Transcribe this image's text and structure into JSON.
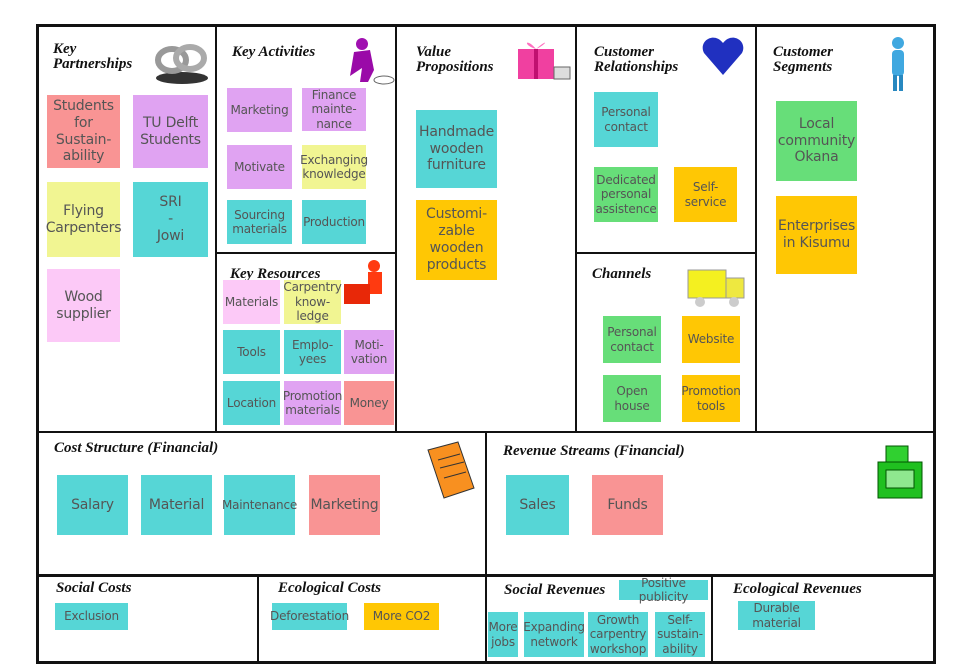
{
  "palette": {
    "red": "#f99494",
    "purple": "#e0a3f2",
    "yellow": "#f1f592",
    "teal": "#56d6d6",
    "lpink": "#fcc9f7",
    "green": "#67de79",
    "orange": "#ffc704"
  },
  "sections": [
    {
      "id": "key-partnerships",
      "title": "Key\nPartnerships",
      "icon": "chain-links-icon",
      "notes": [
        {
          "text": "Students\nfor\nSustain-\nability",
          "color": "red"
        },
        {
          "text": "TU Delft\nStudents",
          "color": "purple"
        },
        {
          "text": "Flying\nCarpenters",
          "color": "yellow"
        },
        {
          "text": "SRI\n-\nJowi",
          "color": "teal"
        },
        {
          "text": "Wood\nsupplier",
          "color": "lpink"
        }
      ]
    },
    {
      "id": "key-activities",
      "title": "Key Activities",
      "icon": "worker-icon",
      "notes": [
        {
          "text": "Marketing",
          "color": "purple"
        },
        {
          "text": "Finance\nmainte-\nnance",
          "color": "purple"
        },
        {
          "text": "Motivate",
          "color": "purple"
        },
        {
          "text": "Exchanging\nknowledge",
          "color": "yellow"
        },
        {
          "text": "Sourcing\nmaterials",
          "color": "teal"
        },
        {
          "text": "Production",
          "color": "teal"
        }
      ]
    },
    {
      "id": "key-resources",
      "title": "Key Resources",
      "icon": "person-with-boxes-icon",
      "notes": [
        {
          "text": "Materials",
          "color": "lpink"
        },
        {
          "text": "Carpentry\nknow-\nledge",
          "color": "yellow"
        },
        {
          "text": "Tools",
          "color": "teal"
        },
        {
          "text": "Emplo-\nyees",
          "color": "teal"
        },
        {
          "text": "Moti-\nvation",
          "color": "purple"
        },
        {
          "text": "Location",
          "color": "teal"
        },
        {
          "text": "Promotion\nmaterials",
          "color": "purple"
        },
        {
          "text": "Money",
          "color": "red"
        }
      ]
    },
    {
      "id": "value-propositions",
      "title": "Value\nPropositions",
      "icon": "gift-icon",
      "notes": [
        {
          "text": "Handmade\nwooden\nfurniture",
          "color": "teal"
        },
        {
          "text": "Customi-\nzable\nwooden\nproducts",
          "color": "orange"
        }
      ]
    },
    {
      "id": "customer-relationships",
      "title": "Customer\nRelationships",
      "icon": "heart-icon",
      "notes": [
        {
          "text": "Personal\ncontact",
          "color": "teal"
        },
        {
          "text": "Dedicated\npersonal\nassistence",
          "color": "green"
        },
        {
          "text": "Self-\nservice",
          "color": "orange"
        }
      ]
    },
    {
      "id": "channels",
      "title": "Channels",
      "icon": "truck-icon",
      "notes": [
        {
          "text": "Personal\ncontact",
          "color": "green"
        },
        {
          "text": "Website",
          "color": "orange"
        },
        {
          "text": "Open\nhouse",
          "color": "green"
        },
        {
          "text": "Promotion\ntools",
          "color": "orange"
        }
      ]
    },
    {
      "id": "customer-segments",
      "title": "Customer\nSegments",
      "icon": "person-icon",
      "notes": [
        {
          "text": "Local\ncommunity\nOkana",
          "color": "green"
        },
        {
          "text": "Enterprises\nin Kisumu",
          "color": "orange"
        }
      ]
    },
    {
      "id": "cost-structure",
      "title": "Cost Structure (Financial)",
      "icon": "receipt-icon",
      "notes": [
        {
          "text": "Salary",
          "color": "teal"
        },
        {
          "text": "Material",
          "color": "teal"
        },
        {
          "text": "Maintenance",
          "color": "teal"
        },
        {
          "text": "Marketing",
          "color": "red"
        }
      ]
    },
    {
      "id": "revenue-streams",
      "title": "Revenue Streams (Financial)",
      "icon": "cash-register-icon",
      "notes": [
        {
          "text": "Sales",
          "color": "teal"
        },
        {
          "text": "Funds",
          "color": "red"
        }
      ]
    },
    {
      "id": "social-costs",
      "title": "Social Costs",
      "icon": "",
      "notes": [
        {
          "text": "Exclusion",
          "color": "teal"
        }
      ]
    },
    {
      "id": "ecological-costs",
      "title": "Ecological Costs",
      "icon": "",
      "notes": [
        {
          "text": "Deforestation",
          "color": "teal"
        },
        {
          "text": "More CO2",
          "color": "orange"
        }
      ]
    },
    {
      "id": "social-revenues",
      "title": "Social Revenues",
      "icon": "",
      "notes": [
        {
          "text": "Positive publicity",
          "color": "teal"
        },
        {
          "text": "More\njobs",
          "color": "teal"
        },
        {
          "text": "Expanding\nnetwork",
          "color": "teal"
        },
        {
          "text": "Growth\ncarpentry\nworkshop",
          "color": "teal"
        },
        {
          "text": "Self-\nsustain-\nability",
          "color": "teal"
        }
      ]
    },
    {
      "id": "ecological-revenues",
      "title": "Ecological Revenues",
      "icon": "",
      "notes": [
        {
          "text": "Durable\nmaterial",
          "color": "teal"
        }
      ]
    }
  ]
}
